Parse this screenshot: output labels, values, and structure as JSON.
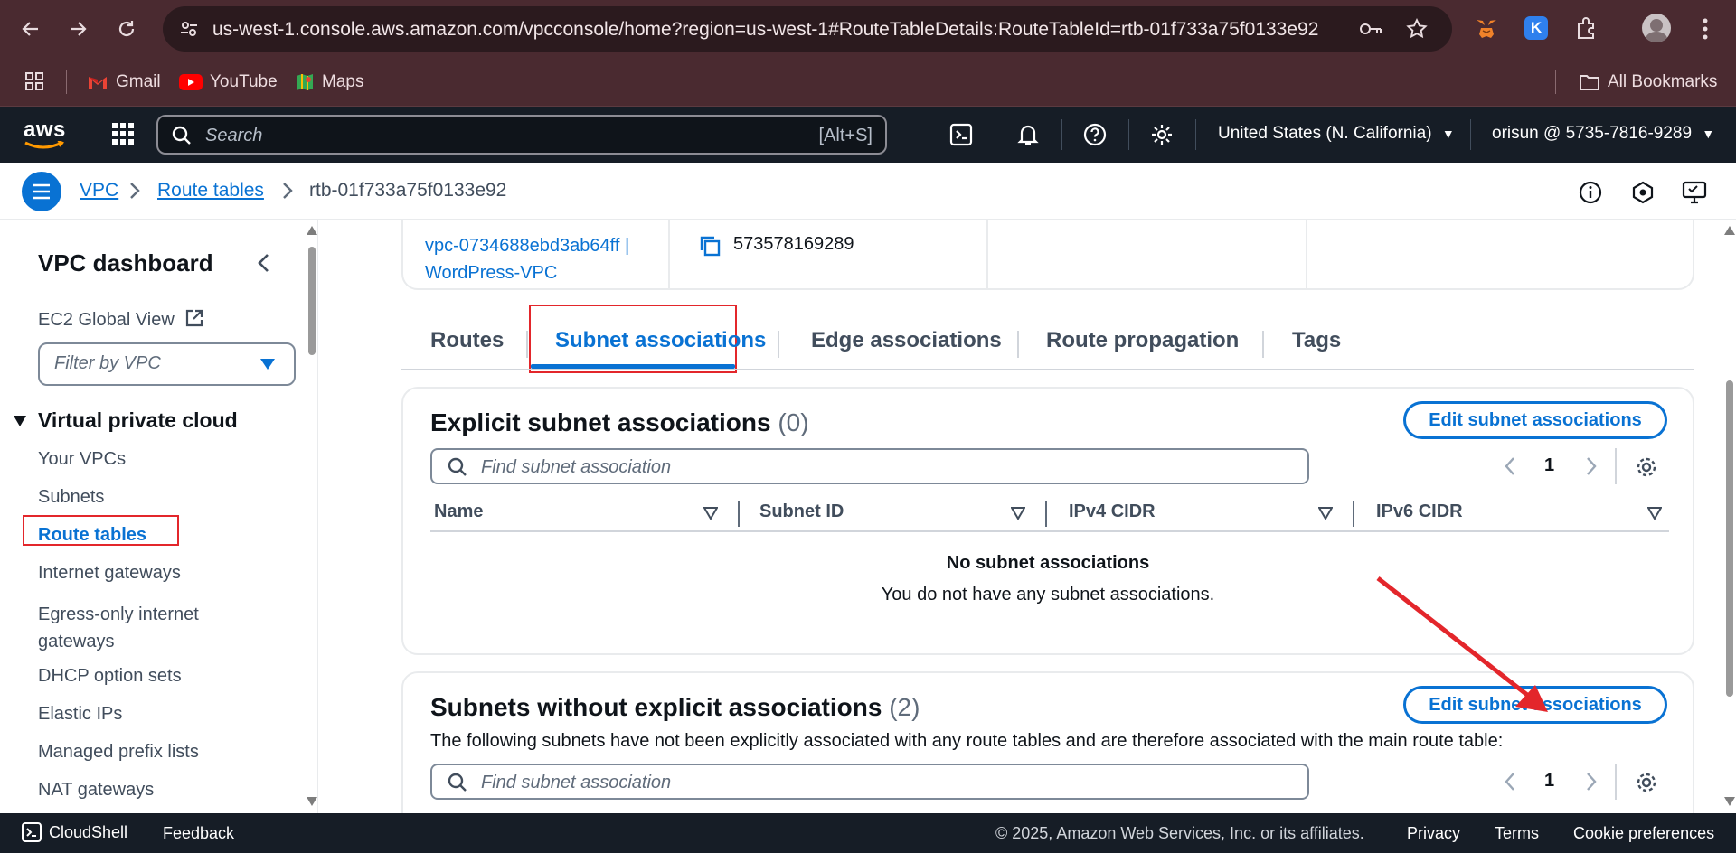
{
  "browser": {
    "url": "us-west-1.console.aws.amazon.com/vpcconsole/home?region=us-west-1#RouteTableDetails:RouteTableId=rtb-01f733a75f0133e92",
    "bookmarks": [
      "Gmail",
      "YouTube",
      "Maps"
    ],
    "all_bookmarks": "All Bookmarks",
    "extension_k_label": "K"
  },
  "aws_header": {
    "logo": "aws",
    "search_placeholder": "Search",
    "search_shortcut": "[Alt+S]",
    "region": "United States (N. California)",
    "account": "orisun @ 5735-7816-9289"
  },
  "breadcrumb": {
    "items": [
      "VPC",
      "Route tables"
    ],
    "current": "rtb-01f733a75f0133e92"
  },
  "sidebar": {
    "title": "VPC dashboard",
    "global_view": "EC2 Global View",
    "filter_placeholder": "Filter by VPC",
    "section": "Virtual private cloud",
    "items": [
      "Your VPCs",
      "Subnets",
      "Route tables",
      "Internet gateways",
      "Egress-only internet gateways",
      "DHCP option sets",
      "Elastic IPs",
      "Managed prefix lists",
      "NAT gateways"
    ],
    "active": "Route tables"
  },
  "details": {
    "vpc_link": "vpc-0734688ebd3ab64ff |",
    "vpc_name": "WordPress-VPC",
    "owner_id": "573578169289"
  },
  "tabs": [
    "Routes",
    "Subnet associations",
    "Edge associations",
    "Route propagation",
    "Tags"
  ],
  "active_tab": "Subnet associations",
  "explicit": {
    "title": "Explicit subnet associations",
    "count": "(0)",
    "edit_button": "Edit subnet associations",
    "search_placeholder": "Find subnet association",
    "page": "1",
    "columns": [
      "Name",
      "Subnet ID",
      "IPv4 CIDR",
      "IPv6 CIDR"
    ],
    "empty_title": "No subnet associations",
    "empty_desc": "You do not have any subnet associations."
  },
  "implicit": {
    "title": "Subnets without explicit associations",
    "count": "(2)",
    "edit_button": "Edit subnet associations",
    "description": "The following subnets have not been explicitly associated with any route tables and are therefore associated with the main route table:",
    "search_placeholder": "Find subnet association",
    "page": "1"
  },
  "footer": {
    "cloudshell": "CloudShell",
    "feedback": "Feedback",
    "copyright": "© 2025, Amazon Web Services, Inc. or its affiliates.",
    "links": [
      "Privacy",
      "Terms",
      "Cookie preferences"
    ]
  },
  "colors": {
    "aws_link": "#0972d3",
    "header_bg": "#161d26",
    "browser_bg": "#4a2a30",
    "annotation_red": "#e3262b"
  }
}
